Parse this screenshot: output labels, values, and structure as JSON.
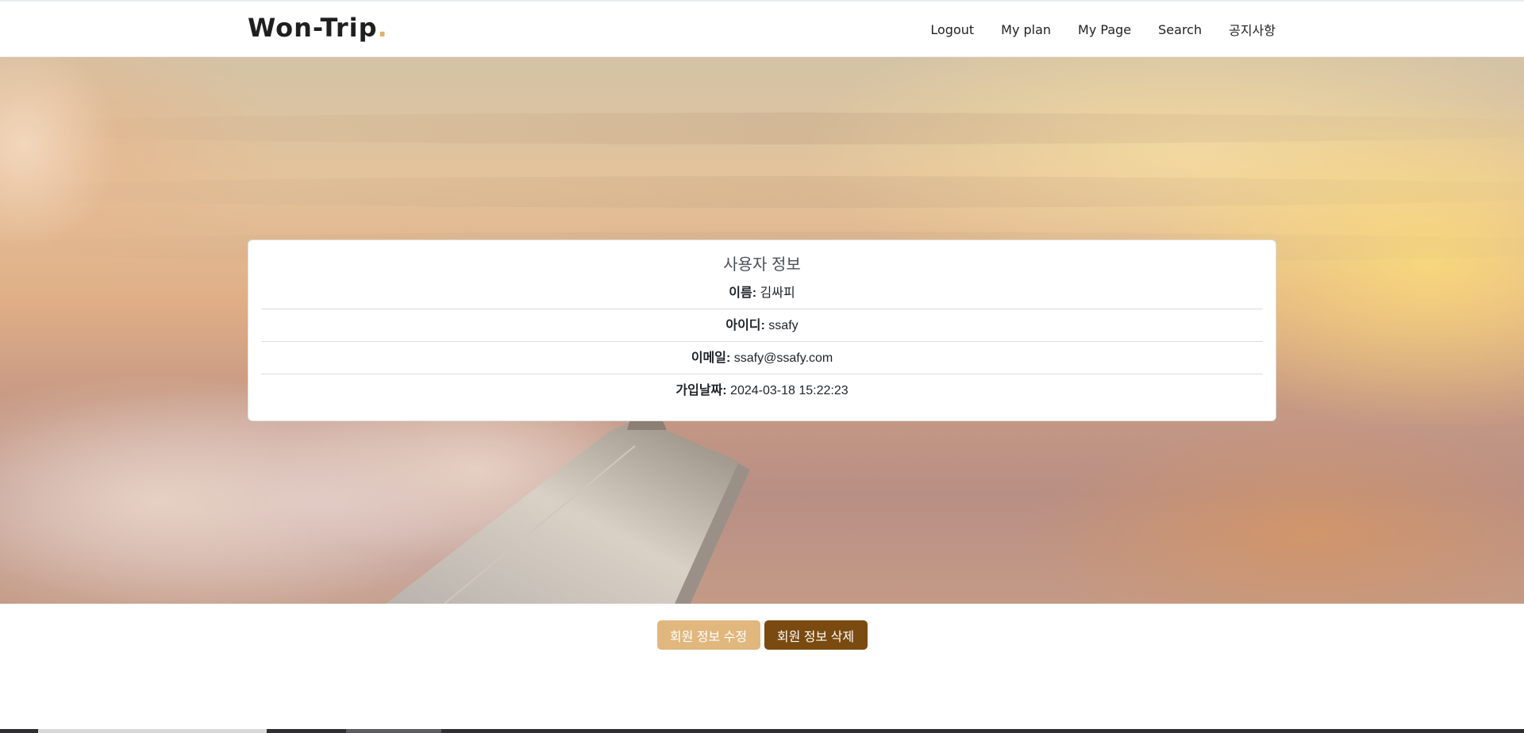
{
  "header": {
    "brand": "Won-Trip",
    "brand_dot": ".",
    "nav": [
      "Logout",
      "My plan",
      "My Page",
      "Search",
      "공지사항"
    ]
  },
  "profile": {
    "title": "사용자 정보",
    "rows": [
      {
        "label": "이름:",
        "value": "김싸피"
      },
      {
        "label": "아이디:",
        "value": "ssafy"
      },
      {
        "label": "이메일:",
        "value": "ssafy@ssafy.com"
      },
      {
        "label": "가입날짜:",
        "value": "2024-03-18 15:22:23"
      }
    ]
  },
  "actions": {
    "edit_label": "회원 정보 수정",
    "delete_label": "회원 정보 삭제"
  },
  "colors": {
    "brand_dot": "#e0b16a",
    "edit_button": "#e1b77e",
    "delete_button": "#7a4a10"
  }
}
